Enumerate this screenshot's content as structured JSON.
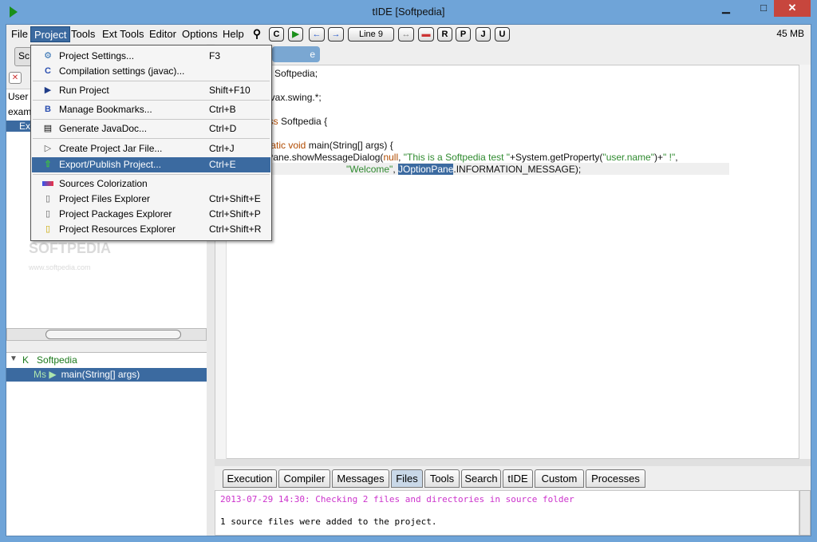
{
  "window": {
    "title": "tIDE [Softpedia]",
    "close_glyph": "✕",
    "minimize_glyph": "▁",
    "maximize_glyph": "□"
  },
  "menubar": {
    "items": [
      "File",
      "Project",
      "Tools",
      "Ext Tools",
      "Editor",
      "Options",
      "Help"
    ],
    "active": "Project"
  },
  "toolbar": {
    "compile_label": "C",
    "back_glyph": "←",
    "forward_glyph": "→",
    "line_label": "Line 9",
    "swap_glyph": "↔",
    "r_label": "R",
    "p_label": "P",
    "j_label": "J",
    "u_label": "U",
    "memory": "45 MB"
  },
  "project_menu": [
    {
      "label": "Project Settings...",
      "shortcut": "F3",
      "icon": "gear-icon",
      "glyph": "⚙"
    },
    {
      "label": "Compilation settings (javac)...",
      "shortcut": "",
      "icon": "c-icon",
      "glyph": "C"
    },
    {
      "label": "Run Project",
      "shortcut": "Shift+F10",
      "icon": "run-icon",
      "glyph": "▶"
    },
    {
      "label": "Manage Bookmarks...",
      "shortcut": "Ctrl+B",
      "icon": "bookmark-icon",
      "glyph": "B"
    },
    {
      "label": "Generate JavaDoc...",
      "shortcut": "Ctrl+D",
      "icon": "javadoc-icon",
      "glyph": "▤"
    },
    {
      "label": "Create Project Jar File...",
      "shortcut": "Ctrl+J",
      "icon": "jar-icon",
      "glyph": "▷"
    },
    {
      "label": "Export/Publish Project...",
      "shortcut": "Ctrl+E",
      "icon": "export-icon",
      "glyph": "⇧"
    },
    {
      "label": "Sources Colorization",
      "shortcut": "",
      "icon": "colorize-icon",
      "glyph": "▬"
    },
    {
      "label": "Project Files Explorer",
      "shortcut": "Ctrl+Shift+E",
      "icon": "file-icon",
      "glyph": "▯"
    },
    {
      "label": "Project Packages Explorer",
      "shortcut": "Ctrl+Shift+P",
      "icon": "package-icon",
      "glyph": "▯"
    },
    {
      "label": "Project Resources Explorer",
      "shortcut": "Ctrl+Shift+R",
      "icon": "resource-icon",
      "glyph": "▯"
    }
  ],
  "left_pane": {
    "tab_label": "Sc",
    "tree": [
      "User",
      "exam",
      "Ex"
    ],
    "outline_class": "Softpedia",
    "outline_class_tag": "K",
    "outline_method_tag": "Ms ▶",
    "outline_method": "main(String[] args)",
    "watermark": "SOFTPEDIA",
    "watermark_url": "www.softpedia.com"
  },
  "editor": {
    "tab_label": "e",
    "lines": {
      "l1": "Softpedia;",
      "l2": "avax.swing.*;",
      "l3_kw": "ass",
      "l3": " Softpedia {",
      "l4_kw": "static void",
      "l4": " main(String[] args) {",
      "l5a": "tionPane.showMessageDialog(",
      "l5_null": "null",
      "l5b": ", ",
      "l5_str": "\"This is a Softpedia test \"",
      "l5c": "+System.getProperty(",
      "l5_str2": "\"user.name\"",
      "l5d": ")+",
      "l5_str3": "\" !\"",
      "l5e": ",",
      "l6_str": "\"Welcome\"",
      "l6a": ", ",
      "l6_sel": "JOptionPane",
      "l6b": ".INFORMATION_MESSAGE);"
    }
  },
  "bottom_tabs": [
    "Execution",
    "Compiler",
    "Messages",
    "Files",
    "Tools",
    "Search",
    "tIDE",
    "Custom",
    "Processes"
  ],
  "bottom_active": "Files",
  "console": {
    "line1": "2013-07-29 14:30: Checking 2 files and directories in source folder",
    "line2": "1 source files were added to the project."
  },
  "colors": {
    "accent": "#3b6aa0",
    "console_highlight": "#cc33cc",
    "title_bar": "#6fa4d8"
  }
}
